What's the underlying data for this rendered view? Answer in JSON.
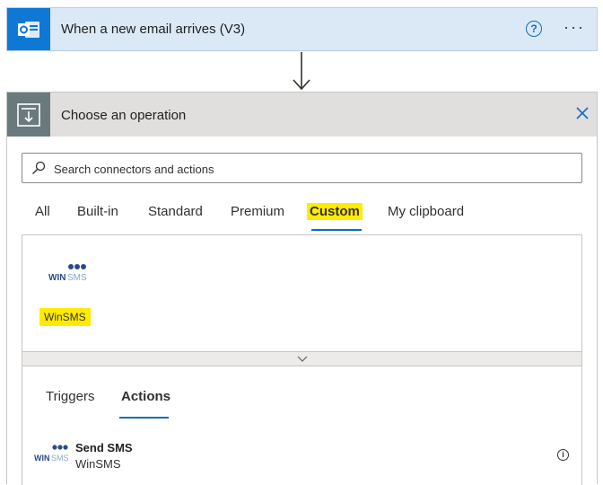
{
  "trigger": {
    "title": "When a new email arrives (V3)",
    "icon": "outlook-icon",
    "help_icon": "?",
    "more_icon": "···",
    "bg": "#dbe9f7",
    "accent": "#0f78d4"
  },
  "operation": {
    "title": "Choose an operation",
    "search_placeholder": "Search connectors and actions",
    "tabs": [
      "All",
      "Built-in",
      "Standard",
      "Premium",
      "Custom",
      "My clipboard"
    ],
    "active_tab": "Custom",
    "connectors": [
      {
        "label": "WinSMS",
        "logo_text": "WIN",
        "logo_text2": "SMS"
      }
    ],
    "sub_tabs": [
      "Triggers",
      "Actions"
    ],
    "active_sub_tab": "Actions",
    "actions": [
      {
        "name": "Send SMS",
        "connector": "WinSMS",
        "info_icon": "i"
      }
    ],
    "highlight": "#ffeb00"
  }
}
